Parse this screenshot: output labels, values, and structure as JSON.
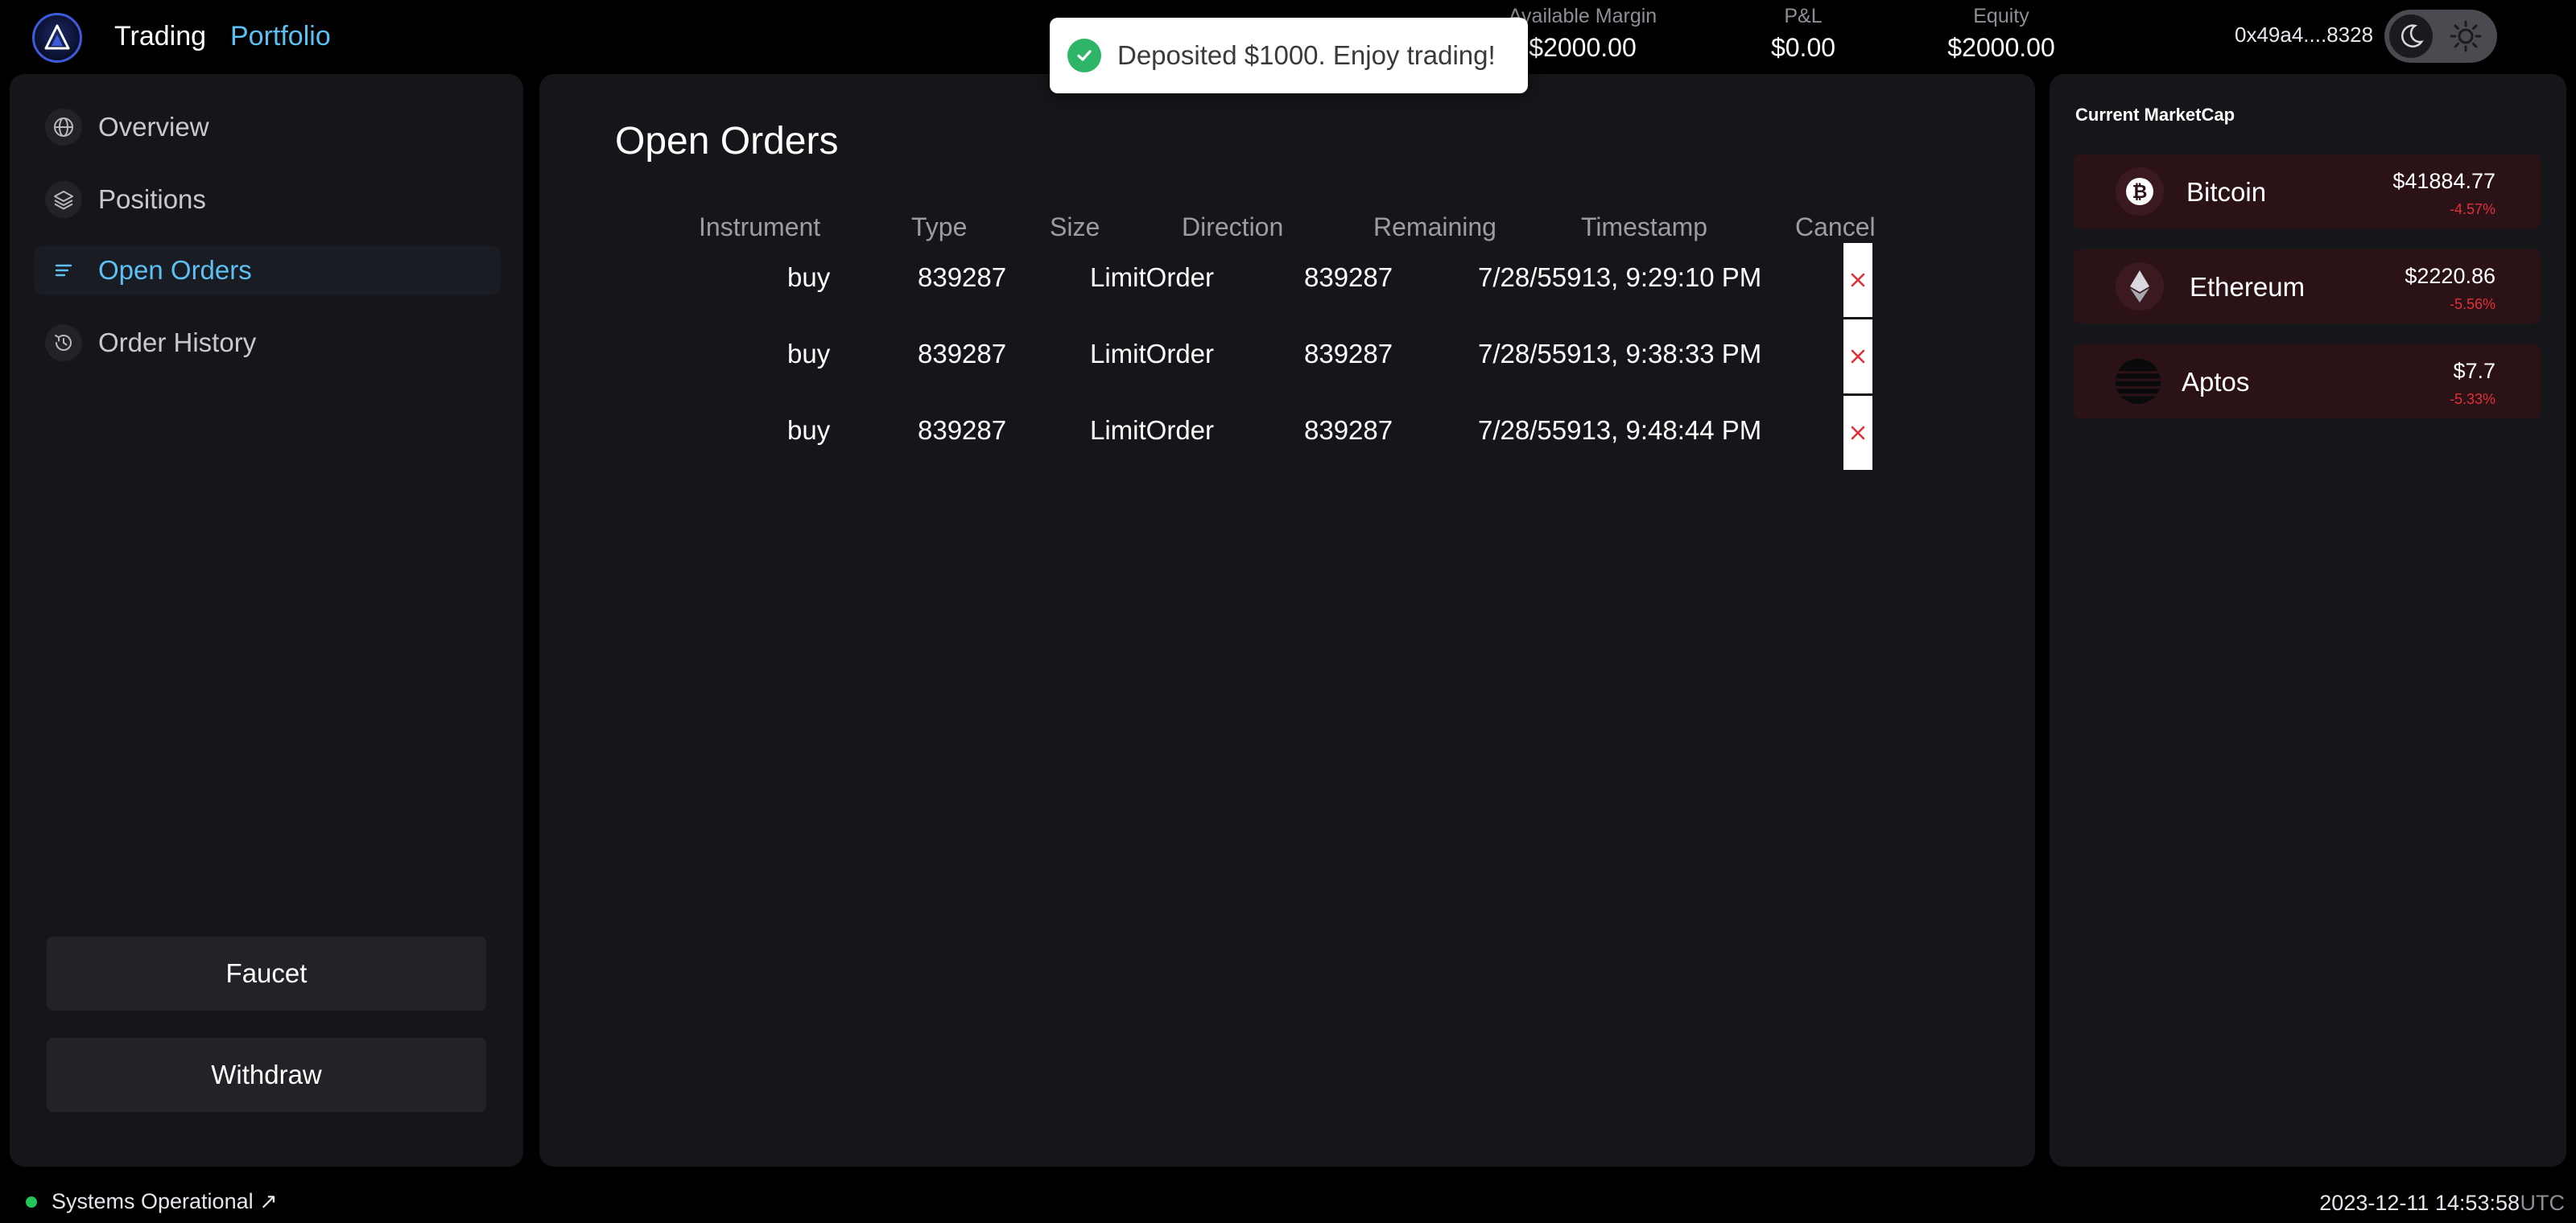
{
  "header": {
    "nav": {
      "trading": "Trading",
      "portfolio": "Portfolio"
    },
    "stats": {
      "margin_label": "Available Margin",
      "margin_value": "$2000.00",
      "pnl_label": "P&L",
      "pnl_value": "$0.00",
      "equity_label": "Equity",
      "equity_value": "$2000.00"
    },
    "wallet": "0x49a4....8328",
    "theme": "dark"
  },
  "toast": {
    "message": "Deposited $1000. Enjoy trading!",
    "type": "success"
  },
  "sidebar": {
    "items": [
      {
        "label": "Overview",
        "icon": "globe-icon",
        "active": false
      },
      {
        "label": "Positions",
        "icon": "layers-icon",
        "active": false
      },
      {
        "label": "Open Orders",
        "icon": "list-icon",
        "active": true
      },
      {
        "label": "Order History",
        "icon": "history-icon",
        "active": false
      }
    ],
    "buttons": {
      "faucet": "Faucet",
      "withdraw": "Withdraw"
    }
  },
  "main": {
    "title": "Open Orders",
    "columns": [
      "Instrument",
      "Type",
      "Size",
      "Direction",
      "Remaining",
      "Timestamp",
      "Cancel"
    ],
    "rows": [
      {
        "instrument": "buy",
        "type": "839287",
        "size": "LimitOrder",
        "direction": "839287",
        "timestamp": "7/28/55913, 9:29:10 PM"
      },
      {
        "instrument": "buy",
        "type": "839287",
        "size": "LimitOrder",
        "direction": "839287",
        "timestamp": "7/28/55913, 9:38:33 PM"
      },
      {
        "instrument": "buy",
        "type": "839287",
        "size": "LimitOrder",
        "direction": "839287",
        "timestamp": "7/28/55913, 9:48:44 PM"
      }
    ]
  },
  "marketcap": {
    "title": "Current MarketCap",
    "coins": [
      {
        "name": "Bitcoin",
        "price": "$41884.77",
        "change": "-4.57%",
        "icon": "bitcoin-icon"
      },
      {
        "name": "Ethereum",
        "price": "$2220.86",
        "change": "-5.56%",
        "icon": "ethereum-icon"
      },
      {
        "name": "Aptos",
        "price": "$7.7",
        "change": "-5.33%",
        "icon": "aptos-icon"
      }
    ],
    "change_color": "#e0313b"
  },
  "footer": {
    "status": "Systems Operational ↗",
    "status_color": "#24c45a",
    "time": "2023-12-11 14:53:58",
    "tz": "UTC"
  },
  "colors": {
    "accent": "#5cc0f2",
    "panel": "#16161a",
    "background": "#000000"
  }
}
